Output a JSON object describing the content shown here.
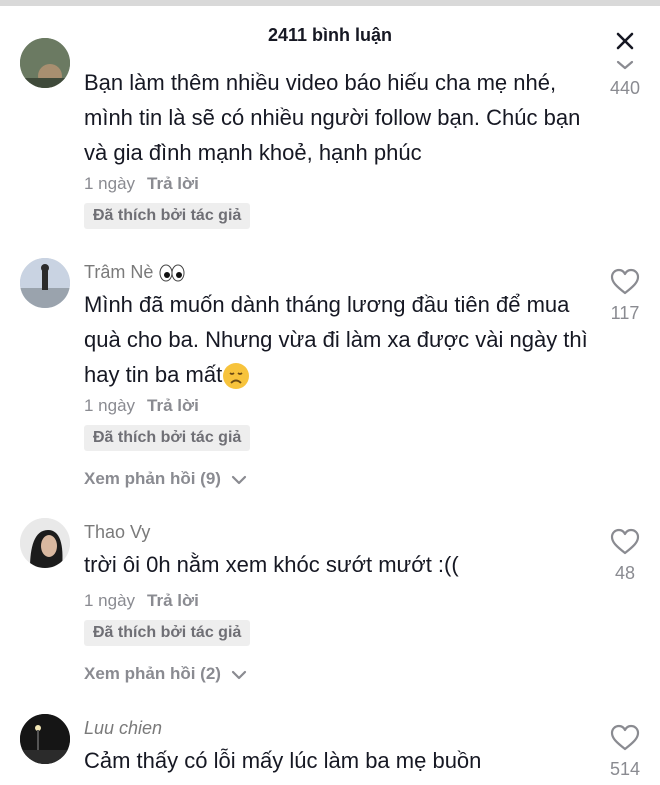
{
  "header": {
    "title": "2411 bình luận"
  },
  "comments": [
    {
      "username": "",
      "text": "Bạn làm thêm nhiều video báo hiếu cha mẹ nhé, mình tin là sẽ có nhiều người follow bạn. Chúc bạn và gia đình mạnh khoẻ, hạnh phúc",
      "time": "1 ngày",
      "reply": "Trả lời",
      "badge": "Đã thích bởi tác giả",
      "likes": "440"
    },
    {
      "username": "Trâm Nè",
      "username_emoji": "eyes-emoji",
      "text": "Mình đã muốn dành tháng lương đầu tiên để mua quà cho ba. Nhưng vừa đi làm xa được vài ngày thì hay tin ba mất",
      "text_emoji": "disappointed-face-emoji",
      "time": "1 ngày",
      "reply": "Trả lời",
      "badge": "Đã thích bởi tác giả",
      "view_replies": "Xem phản hồi (9)",
      "likes": "117"
    },
    {
      "username": "Thao Vy",
      "text": "trời ôi 0h nằm xem khóc sướt mướt :((",
      "time": "1 ngày",
      "reply": "Trả lời",
      "badge": "Đã thích bởi tác giả",
      "view_replies": "Xem phản hồi (2)",
      "likes": "48"
    },
    {
      "username": "Luu chien",
      "text": "Cảm thấy có lỗi mấy lúc làm ba mẹ buồn",
      "likes": "514"
    }
  ],
  "icons": {
    "close": "close-icon",
    "like": "heart-outline-icon",
    "chevron": "chevron-down-icon"
  },
  "colors": {
    "text": "#161823",
    "muted": "#8a8b91",
    "badge_bg": "#eeeeee"
  }
}
